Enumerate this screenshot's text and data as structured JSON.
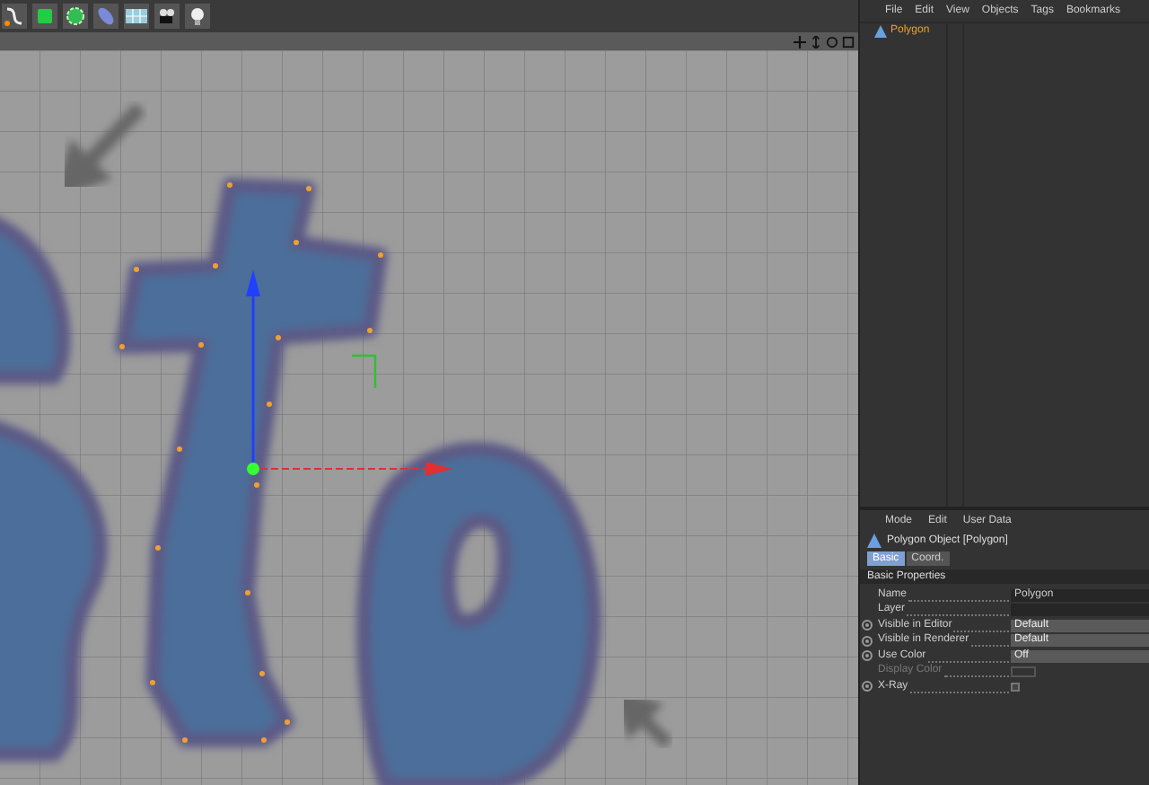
{
  "object_manager": {
    "menu": [
      "File",
      "Edit",
      "View",
      "Objects",
      "Tags",
      "Bookmarks"
    ],
    "objects": [
      {
        "name": "Polygon",
        "selected": true
      }
    ]
  },
  "attributes": {
    "menu": [
      "Mode",
      "Edit",
      "User Data"
    ],
    "title": "Polygon Object [Polygon]",
    "tabs": [
      {
        "label": "Basic",
        "selected": true
      },
      {
        "label": "Coord.",
        "selected": false
      }
    ],
    "section": "Basic Properties",
    "properties": [
      {
        "label": "Name",
        "kind": "text",
        "value": "Polygon",
        "animatable": false,
        "disabled": false
      },
      {
        "label": "Layer",
        "kind": "text",
        "animatable": false,
        "disabled": false
      },
      {
        "label": "Visible in Editor",
        "kind": "dropdown",
        "value": "Default",
        "animatable": true,
        "disabled": false
      },
      {
        "label": "Visible in Renderer",
        "kind": "dropdown",
        "value": "Default",
        "animatable": true,
        "disabled": false
      },
      {
        "label": "Use Color",
        "kind": "dropdown",
        "value": "Off",
        "animatable": true,
        "disabled": false
      },
      {
        "label": "Display Color",
        "kind": "color",
        "animatable": false,
        "disabled": true
      },
      {
        "label": "X-Ray",
        "kind": "checkbox",
        "checked": false,
        "animatable": true,
        "disabled": false
      }
    ]
  }
}
